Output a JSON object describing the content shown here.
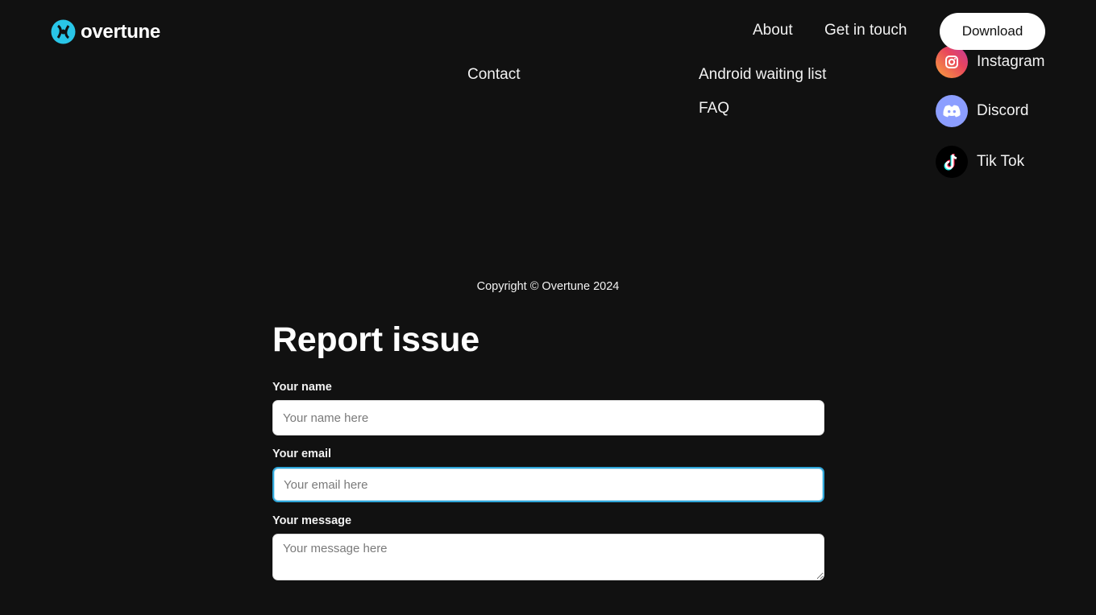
{
  "header": {
    "brand": "overtune",
    "nav": [
      {
        "label": "About"
      },
      {
        "label": "Get in touch"
      }
    ],
    "download_label": "Download",
    "accent_color": "#29c6e8"
  },
  "footer": {
    "col1": [
      "Contact"
    ],
    "col2": [
      "Android waiting list",
      "FAQ"
    ],
    "socials": [
      {
        "label": "Instagram",
        "icon": "instagram-icon"
      },
      {
        "label": "Discord",
        "icon": "discord-icon"
      },
      {
        "label": "Tik Tok",
        "icon": "tiktok-icon"
      }
    ],
    "copyright": "Copyright © Overtune 2024"
  },
  "form": {
    "title": "Report issue",
    "fields": [
      {
        "label": "Your name",
        "placeholder": "Your name here",
        "value": ""
      },
      {
        "label": "Your email",
        "placeholder": "Your email here",
        "value": ""
      },
      {
        "label": "Your message",
        "placeholder": "Your message here",
        "value": ""
      }
    ]
  }
}
